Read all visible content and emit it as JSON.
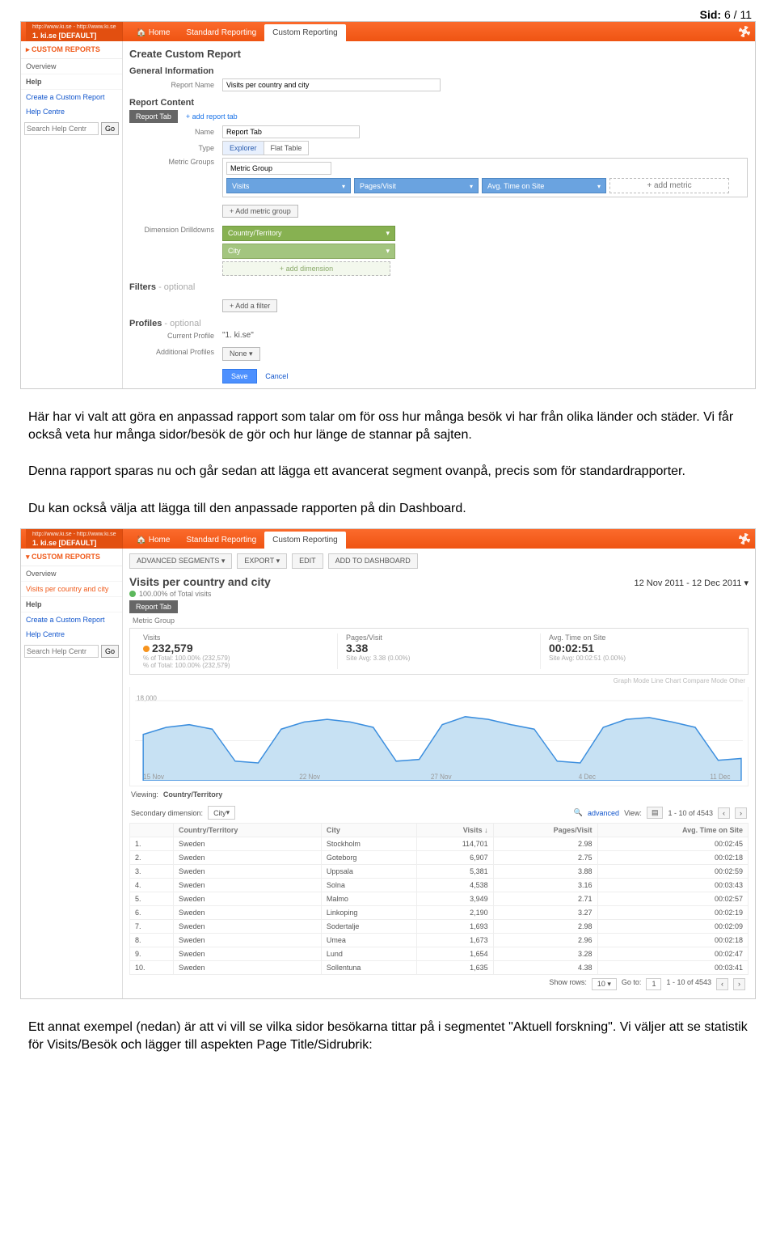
{
  "page_header": {
    "sid_label": "Sid:",
    "sid_value": "6 / 11"
  },
  "para1": "Här har vi valt att göra en anpassad rapport som talar om för oss hur många besök vi har från olika länder och städer. Vi får också veta hur många sidor/besök de gör och hur länge de stannar på sajten.",
  "para2": "Denna rapport sparas nu och går sedan att lägga ett avancerat segment ovanpå, precis som för standardrapporter.",
  "para3": "Du kan också välja att lägga till den anpassade rapporten på din Dashboard.",
  "para4": "Ett annat exempel (nedan) är att vi vill se vilka sidor besökarna tittar på i segmentet \"Aktuell forskning\". Vi väljer att se statistik för Visits/Besök och lägger till aspekten Page Title/Sidrubrik:",
  "ga_common": {
    "prop_url": "http://www.ki.se - http://www.ki.se",
    "prop_name": "1. ki.se [DEFAULT]",
    "home_tab": "Home",
    "std_tab": "Standard Reporting",
    "custom_tab": "Custom Reporting",
    "sidebar": {
      "section1": "CUSTOM REPORTS",
      "overview": "Overview",
      "report_item": "Visits per country and city",
      "help": "Help",
      "create_link": "Create a Custom Report",
      "help_centre": "Help Centre",
      "search_placeholder": "Search Help Centr",
      "go": "Go"
    }
  },
  "shot1": {
    "title": "Create Custom Report",
    "sec_general": "General Information",
    "report_name_label": "Report Name",
    "report_name_value": "Visits per country and city",
    "sec_content": "Report Content",
    "report_tab_label": "Report Tab",
    "add_report_tab": "+ add report tab",
    "name_label": "Name",
    "name_value": "Report Tab",
    "type_label": "Type",
    "type_explorer": "Explorer",
    "type_flat": "Flat Table",
    "mg_label": "Metric Groups",
    "mg_name": "Metric Group",
    "metrics": [
      "Visits",
      "Pages/Visit",
      "Avg. Time on Site"
    ],
    "add_metric": "+ add metric",
    "add_mg": "+ Add metric group",
    "dd_label": "Dimension Drilldowns",
    "dims": [
      "Country/Territory",
      "City"
    ],
    "add_dim": "+ add dimension",
    "filters_h": "Filters",
    "optional": "- optional",
    "add_filter": "+ Add a filter",
    "profiles_h": "Profiles",
    "cur_profile_label": "Current Profile",
    "cur_profile_value": "\"1. ki.se\"",
    "add_profiles_label": "Additional Profiles",
    "add_profiles_value": "None",
    "save": "Save",
    "cancel": "Cancel"
  },
  "shot2": {
    "toolbar": [
      "ADVANCED SEGMENTS",
      "EXPORT",
      "EDIT",
      "ADD TO DASHBOARD"
    ],
    "title": "Visits per country and city",
    "subtitle": "100.00% of Total visits",
    "date_range": "12 Nov 2011 - 12 Dec 2011",
    "tab_report": "Report Tab",
    "mg_label": "Metric Group",
    "kpis": [
      {
        "label": "Visits",
        "value": "232,579",
        "sub": "% of Total: 100.00% (232,579)",
        "dot": true
      },
      {
        "label": "Pages/Visit",
        "value": "3.38",
        "sub": "Site Avg: 3.38 (0.00%)"
      },
      {
        "label": "Avg. Time on Site",
        "value": "00:02:51",
        "sub": "Site Avg: 00:02:51 (0.00%)"
      }
    ],
    "chart_right_label": "Graph Mode   Line Chart   Compare Mode   Other",
    "ylabels": [
      "18,000"
    ],
    "xlabels": [
      "15 Nov",
      "22 Nov",
      "27 Nov",
      "4 Dec",
      "11 Dec"
    ],
    "viewing_label": "Viewing:",
    "viewing_value": "Country/Territory",
    "secdim_label": "Secondary dimension:",
    "secdim_value": "City",
    "advanced": "advanced",
    "view_word": "View:",
    "row_range": "1 - 10 of 4543",
    "columns": [
      "",
      "Country/Territory",
      "City",
      "Visits",
      "Pages/Visit",
      "Avg. Time on Site"
    ],
    "rows": [
      [
        "1.",
        "Sweden",
        "Stockholm",
        "114,701",
        "2.98",
        "00:02:45"
      ],
      [
        "2.",
        "Sweden",
        "Goteborg",
        "6,907",
        "2.75",
        "00:02:18"
      ],
      [
        "3.",
        "Sweden",
        "Uppsala",
        "5,381",
        "3.88",
        "00:02:59"
      ],
      [
        "4.",
        "Sweden",
        "Solna",
        "4,538",
        "3.16",
        "00:03:43"
      ],
      [
        "5.",
        "Sweden",
        "Malmo",
        "3,949",
        "2.71",
        "00:02:57"
      ],
      [
        "6.",
        "Sweden",
        "Linkoping",
        "2,190",
        "3.27",
        "00:02:19"
      ],
      [
        "7.",
        "Sweden",
        "Sodertalje",
        "1,693",
        "2.98",
        "00:02:09"
      ],
      [
        "8.",
        "Sweden",
        "Umea",
        "1,673",
        "2.96",
        "00:02:18"
      ],
      [
        "9.",
        "Sweden",
        "Lund",
        "1,654",
        "3.28",
        "00:02:47"
      ],
      [
        "10.",
        "Sweden",
        "Sollentuna",
        "1,635",
        "4.38",
        "00:03:41"
      ]
    ],
    "show_rows": "Show rows:",
    "show_rows_val": "10",
    "goto": "Go to:",
    "goto_val": "1",
    "foot_range": "1 - 10 of 4543"
  },
  "chart_data": {
    "type": "line",
    "title": "Visits",
    "ylabel": "Visits",
    "ylim": [
      0,
      18000
    ],
    "x": [
      "15 Nov",
      "16 Nov",
      "17 Nov",
      "18 Nov",
      "19 Nov",
      "20 Nov",
      "21 Nov",
      "22 Nov",
      "23 Nov",
      "24 Nov",
      "25 Nov",
      "26 Nov",
      "27 Nov",
      "28 Nov",
      "29 Nov",
      "30 Nov",
      "1 Dec",
      "2 Dec",
      "3 Dec",
      "4 Dec",
      "5 Dec",
      "6 Dec",
      "7 Dec",
      "8 Dec",
      "9 Dec",
      "10 Dec",
      "11 Dec"
    ],
    "values": [
      9500,
      11000,
      11500,
      10500,
      4500,
      4000,
      10500,
      12000,
      12500,
      12000,
      11000,
      4500,
      4800,
      11500,
      13000,
      12500,
      11500,
      10500,
      4500,
      4200,
      11000,
      12500,
      12800,
      12000,
      11000,
      4800,
      5000
    ]
  }
}
